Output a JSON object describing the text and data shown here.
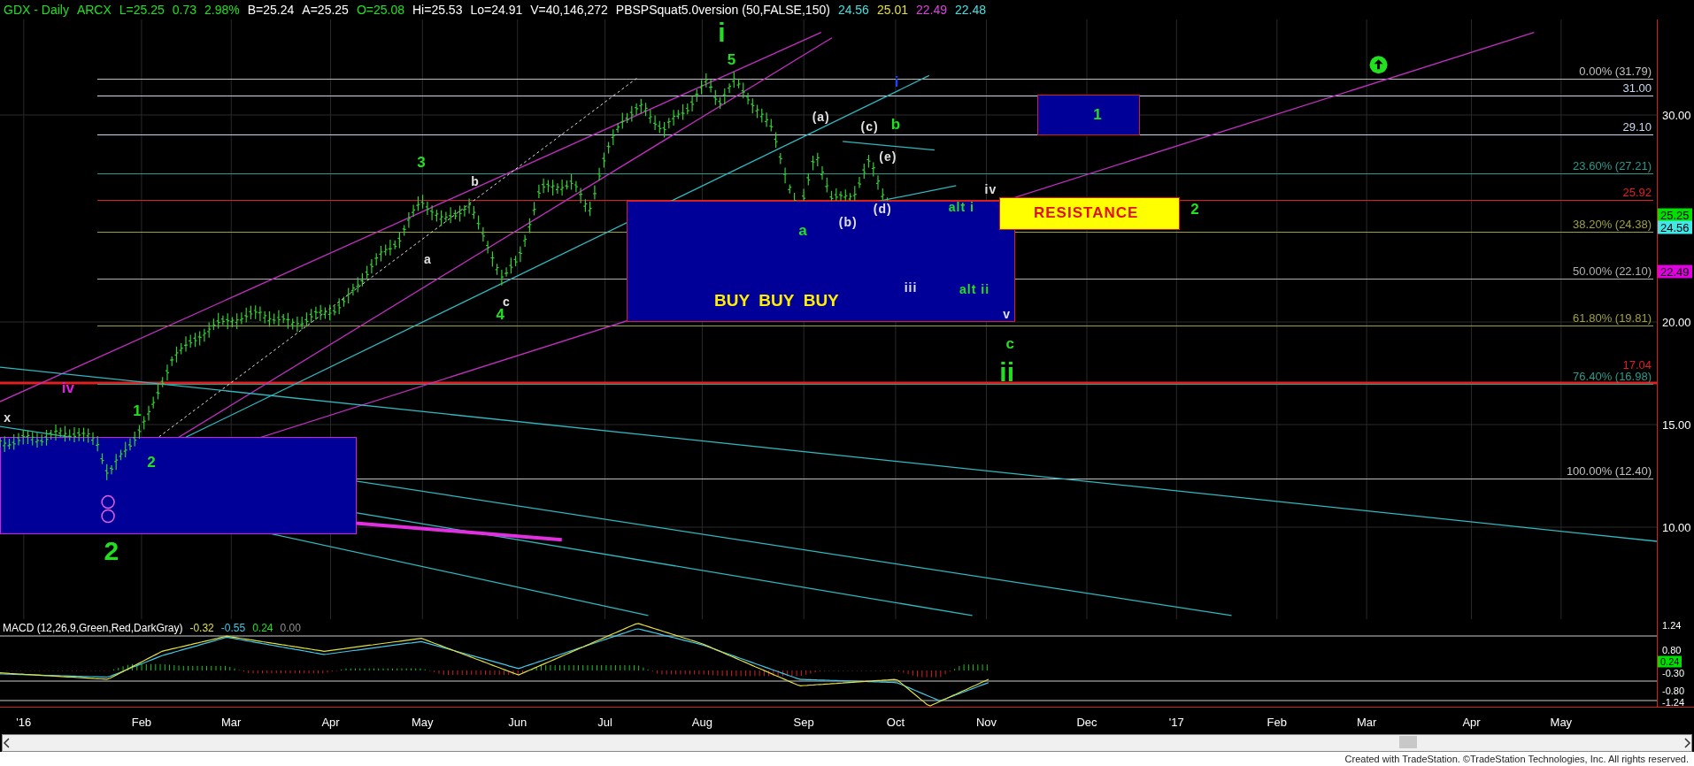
{
  "header": {
    "items": [
      {
        "text": "GDX - Daily",
        "color": "#20e020"
      },
      {
        "text": "ARCX",
        "color": "#20e020"
      },
      {
        "text": "L=25.25",
        "color": "#20e020"
      },
      {
        "text": "0.73",
        "color": "#20e020"
      },
      {
        "text": "2.98%",
        "color": "#20e020"
      },
      {
        "text": "B=25.24",
        "color": "#ffffff"
      },
      {
        "text": "A=25.25",
        "color": "#ffffff"
      },
      {
        "text": "O=25.08",
        "color": "#20e020"
      },
      {
        "text": "Hi=25.53",
        "color": "#ffffff"
      },
      {
        "text": "Lo=24.91",
        "color": "#ffffff"
      },
      {
        "text": "V=40,146,272",
        "color": "#ffffff"
      },
      {
        "text": "PBSPSquat5.0version (50,FALSE,150)",
        "color": "#ffffff"
      },
      {
        "text": "24.56",
        "color": "#40e0e0"
      },
      {
        "text": "25.01",
        "color": "#e0e040"
      },
      {
        "text": "22.49",
        "color": "#e040e0"
      },
      {
        "text": "22.48",
        "color": "#40e0e0"
      }
    ]
  },
  "price_axis": {
    "ticks": [
      "30.00",
      "20.00",
      "15.00",
      "10.00"
    ],
    "tags": [
      {
        "text": "25.25",
        "color": "#00e000"
      },
      {
        "text": "24.56",
        "color": "#40e8e8"
      },
      {
        "text": "22.49",
        "color": "#e000e0"
      }
    ]
  },
  "fib_levels": [
    {
      "label": "0.00% (31.79)",
      "color": "#c0c0c0",
      "kind": "level"
    },
    {
      "label": "31.00",
      "color": "#c8d8f0",
      "kind": "level"
    },
    {
      "label": "29.10",
      "color": "#c8d8f0",
      "kind": "level"
    },
    {
      "label": "23.60% (27.21)",
      "color": "#2a9a8a",
      "kind": "level"
    },
    {
      "label": "25.92",
      "color": "#e02020",
      "kind": "level"
    },
    {
      "label": "38.20% (24.38)",
      "color": "#a0a040",
      "kind": "level"
    },
    {
      "label": "50.00% (22.10)",
      "color": "#b0b0b0",
      "kind": "level"
    },
    {
      "label": "61.80% (19.81)",
      "color": "#a0a040",
      "kind": "level"
    },
    {
      "label": "17.04",
      "color": "#e02020",
      "kind": "major"
    },
    {
      "label": "76.40% (16.98)",
      "color": "#2a9a8a",
      "kind": "level"
    },
    {
      "label": "100.00% (12.40)",
      "color": "#c0c0c0",
      "kind": "level"
    }
  ],
  "zones": {
    "buy": "BUY  BUY  BUY",
    "resistance": "RESISTANCE",
    "target": "1"
  },
  "wave_labels": [
    {
      "text": "i",
      "color": "#20e020",
      "kind": "major"
    },
    {
      "text": "5",
      "color": "#20e020",
      "kind": "minor"
    },
    {
      "text": "i",
      "color": "#2040ff",
      "kind": "minor"
    },
    {
      "text": "(a)",
      "color": "#e0e0e0",
      "kind": "small"
    },
    {
      "text": "(c)",
      "color": "#e0e0e0",
      "kind": "small"
    },
    {
      "text": "b",
      "color": "#20e020",
      "kind": "minor"
    },
    {
      "text": "3",
      "color": "#20e020",
      "kind": "minor"
    },
    {
      "text": "b",
      "color": "#e0e0e0",
      "kind": "small"
    },
    {
      "text": "(e)",
      "color": "#e0e0e0",
      "kind": "small"
    },
    {
      "text": "iv",
      "color": "#e0e0e0",
      "kind": "small"
    },
    {
      "text": "(d)",
      "color": "#e0e0e0",
      "kind": "small"
    },
    {
      "text": "alt i",
      "color": "#20e020",
      "kind": "small"
    },
    {
      "text": "(b)",
      "color": "#e0e0e0",
      "kind": "small"
    },
    {
      "text": "a",
      "color": "#20e020",
      "kind": "minor"
    },
    {
      "text": "a",
      "color": "#e0e0e0",
      "kind": "small"
    },
    {
      "text": "iii",
      "color": "#e0e0e0",
      "kind": "small"
    },
    {
      "text": "alt ii",
      "color": "#20e020",
      "kind": "small"
    },
    {
      "text": "c",
      "color": "#e0e0e0",
      "kind": "small"
    },
    {
      "text": "4",
      "color": "#20e020",
      "kind": "minor"
    },
    {
      "text": "v",
      "color": "#e0e0e0",
      "kind": "small"
    },
    {
      "text": "c",
      "color": "#20e020",
      "kind": "minor"
    },
    {
      "text": "ii",
      "color": "#20e020",
      "kind": "major"
    },
    {
      "text": "iv",
      "color": "#e020e0",
      "kind": "minor"
    },
    {
      "text": "1",
      "color": "#20e020",
      "kind": "minor"
    },
    {
      "text": "2",
      "color": "#20e020",
      "kind": "minor"
    },
    {
      "text": "2",
      "color": "#20e020",
      "kind": "major"
    },
    {
      "text": "2",
      "color": "#20e020",
      "kind": "minor"
    },
    {
      "text": "x",
      "color": "#e0e0e0",
      "kind": "small"
    }
  ],
  "macd": {
    "title": "MACD (12,26,9,Green,Red,DarkGray)",
    "values": [
      {
        "text": "-0.32",
        "color": "#e0e040"
      },
      {
        "text": "-0.55",
        "color": "#40c8e8"
      },
      {
        "text": "0.24",
        "color": "#20e020"
      },
      {
        "text": "0.00",
        "color": "#909090"
      }
    ],
    "ticks": [
      "1.24",
      "0.80",
      "-0.30",
      "-0.80",
      "-1.24"
    ],
    "tag": "0.24"
  },
  "date_axis": [
    "'16",
    "Feb",
    "Mar",
    "Apr",
    "May",
    "Jun",
    "Jul",
    "Aug",
    "Sep",
    "Oct",
    "Nov",
    "Dec",
    "'17",
    "Feb",
    "Mar",
    "Apr",
    "May"
  ],
  "footer": "Created with TradeStation. ©TradeStation Technologies, Inc. All rights reserved."
}
